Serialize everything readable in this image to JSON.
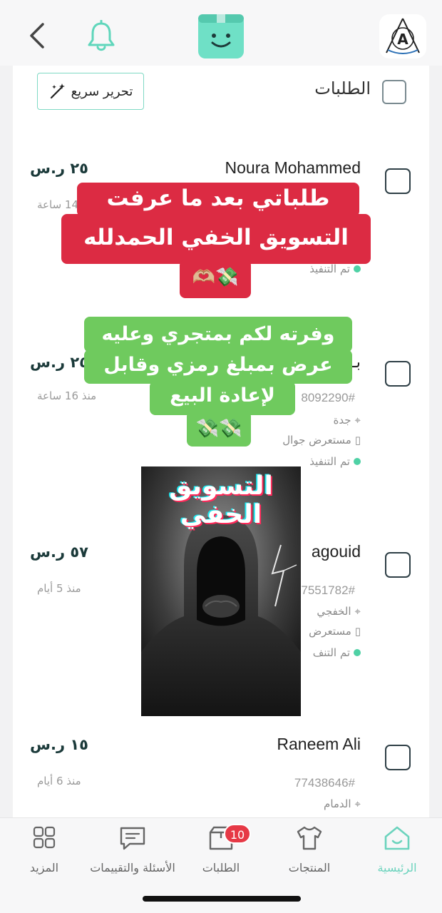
{
  "header": {
    "back_icon": "chevron-left-icon",
    "bell_icon": "bell-icon",
    "logo_icon": "smiling-box-logo",
    "brand_icon": "arrow-a-brand-logo"
  },
  "orders_header": {
    "title": "الطلبات",
    "quick_edit_label": "تحرير سريع",
    "quick_edit_icon": "magic-wand-icon"
  },
  "orders": [
    {
      "name": "Noura Mohammed",
      "price": "٢٥ ر.س",
      "time": "14 ساعة",
      "status": "تم التنفيذ"
    },
    {
      "name": "بـ",
      "price": "٢٥ ر.س",
      "time": "منذ 16 ساعة",
      "number": "8092290#",
      "city": "جدة",
      "device": "مستعرض جوال",
      "status": "تم التنفيذ"
    },
    {
      "name": "agouid",
      "price": "٥٧ ر.س",
      "time": "منذ 5 أيام",
      "number": "7551782#",
      "city": "الخفجي",
      "device": "مستعرض",
      "status": "تم التنف"
    },
    {
      "name": "Raneem Ali",
      "price": "١٥ ر.س",
      "time": "منذ 6 أيام",
      "number": "77438646#",
      "city": "الدمام"
    }
  ],
  "overlays": {
    "red_line1": "طلباتي بعد ما عرفت",
    "red_line2": "التسويق الخفي الحمدلله",
    "red_emoji": "💸🫶🏼",
    "green_line1": "وفرته لكم بمتجري وعليه",
    "green_line2": "عرض بمبلغ رمزي وقابل",
    "green_line3": "لإعادة البيع",
    "green_emoji": "💸💸",
    "image_title_line1": "التسويق",
    "image_title_line2": "الخفي"
  },
  "bottom_nav": [
    {
      "label": "الرئيسية",
      "icon": "home-icon",
      "active": true
    },
    {
      "label": "المنتجات",
      "icon": "shirt-icon"
    },
    {
      "label": "الطلبات",
      "icon": "box-icon",
      "badge": "10"
    },
    {
      "label": "الأسئلة والتقييمات",
      "icon": "chat-icon"
    },
    {
      "label": "المزيد",
      "icon": "grid-icon"
    }
  ],
  "colors": {
    "accent": "#6fe0c6",
    "red_overlay": "#dc2b43",
    "green_overlay": "#6fca5e",
    "badge": "#e63946"
  }
}
